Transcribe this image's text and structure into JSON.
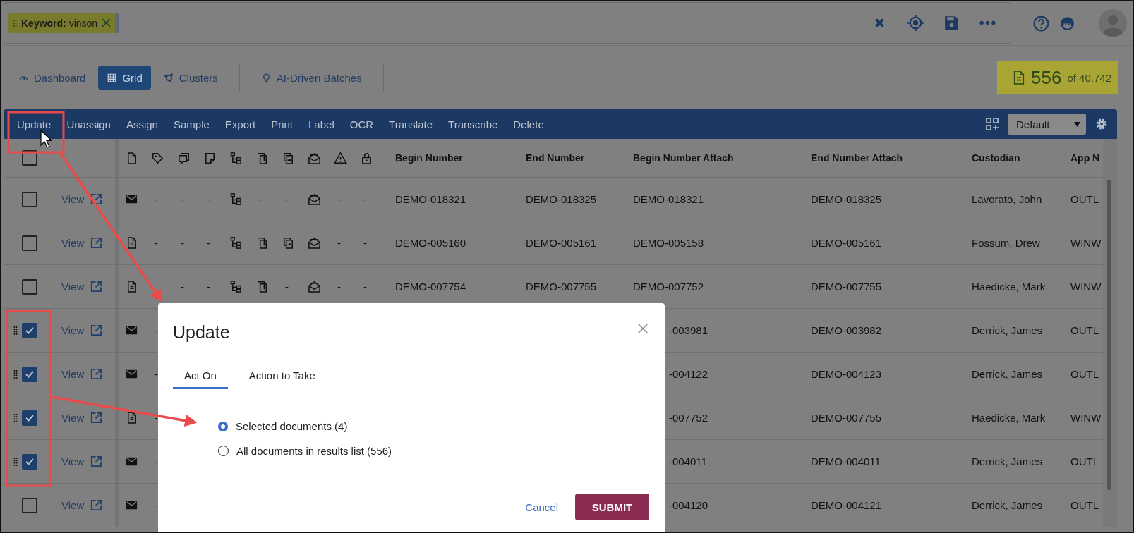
{
  "search_bar": {
    "chip": "**Keyword:** vinson"
  },
  "nav_tabs": [
    {
      "label": "Dashboard",
      "kind": "dashboard",
      "selected": false
    },
    {
      "label": "Grid",
      "kind": "grid",
      "selected": true
    },
    {
      "label": "Clusters",
      "kind": "clusters",
      "selected": false
    },
    {
      "label": "AI-Driven Batches",
      "kind": "batches",
      "selected": false
    }
  ],
  "result_count": {
    "count": "556",
    "total": "of 40,742"
  },
  "toolbar": {
    "actions": [
      "Update",
      "Unassign",
      "Assign",
      "Sample",
      "Export",
      "Print",
      "Label",
      "OCR",
      "Translate",
      "Transcribe",
      "Delete"
    ],
    "layout_select": "Default"
  },
  "table": {
    "header_checked": false,
    "columns": [
      "Begin Number",
      "End Number",
      "Begin Number Attach",
      "End Number Attach",
      "Custodian",
      "App N"
    ],
    "rows": [
      {
        "checked": false,
        "view": "View",
        "icons": [
          {
            "kind": "email"
          },
          {
            "kind": "dash",
            "text": "-"
          },
          {
            "kind": "dash",
            "text": "-"
          },
          {
            "kind": "dash",
            "text": "-"
          },
          {
            "kind": "family"
          },
          {
            "kind": "dash",
            "text": "-"
          },
          {
            "kind": "dash",
            "text": "-"
          },
          {
            "kind": "thread"
          },
          {
            "kind": "dash",
            "text": "-"
          },
          {
            "kind": "dash",
            "text": "-"
          }
        ],
        "cells": [
          "DEMO-018321",
          "DEMO-018325",
          "DEMO-018321",
          "DEMO-018325",
          "Lavorato, John",
          "OUTL"
        ]
      },
      {
        "checked": false,
        "view": "View",
        "icons": [
          {
            "kind": "doc"
          },
          {
            "kind": "dash",
            "text": "-"
          },
          {
            "kind": "dash",
            "text": "-"
          },
          {
            "kind": "dash",
            "text": "-"
          },
          {
            "kind": "family"
          },
          {
            "kind": "copies"
          },
          {
            "kind": "duplicate"
          },
          {
            "kind": "thread"
          },
          {
            "kind": "dash",
            "text": "-"
          },
          {
            "kind": "dash",
            "text": "-"
          }
        ],
        "cells": [
          "DEMO-005160",
          "DEMO-005161",
          "DEMO-005158",
          "DEMO-005161",
          "Fossum, Drew",
          "WINW"
        ]
      },
      {
        "checked": false,
        "view": "View",
        "icons": [
          {
            "kind": "doc"
          },
          {
            "kind": "blank"
          },
          {
            "kind": "dash",
            "text": "-"
          },
          {
            "kind": "dash",
            "text": "-"
          },
          {
            "kind": "family"
          },
          {
            "kind": "copies"
          },
          {
            "kind": "dash",
            "text": "-"
          },
          {
            "kind": "thread"
          },
          {
            "kind": "dash",
            "text": "-"
          },
          {
            "kind": "dash",
            "text": "-"
          }
        ],
        "cells": [
          "DEMO-007754",
          "DEMO-007755",
          "DEMO-007752",
          "DEMO-007755",
          "Haedicke, Mark",
          "WINW"
        ]
      },
      {
        "checked": true,
        "view": "View",
        "icons": [
          {
            "kind": "email"
          },
          {
            "kind": "dash",
            "text": "-"
          }
        ],
        "cells": [
          null,
          null,
          "-003981",
          "DEMO-003982",
          "Derrick, James",
          "OUTL"
        ]
      },
      {
        "checked": true,
        "view": "View",
        "icons": [
          {
            "kind": "email"
          },
          {
            "kind": "dash",
            "text": "-"
          }
        ],
        "cells": [
          null,
          null,
          "-004122",
          "DEMO-004123",
          "Derrick, James",
          "OUTL"
        ]
      },
      {
        "checked": true,
        "view": "View",
        "icons": [
          {
            "kind": "doc"
          },
          {
            "kind": "dash",
            "text": "-"
          }
        ],
        "cells": [
          null,
          null,
          "-007752",
          "DEMO-007755",
          "Haedicke, Mark",
          "WINW"
        ]
      },
      {
        "checked": true,
        "view": "View",
        "icons": [
          {
            "kind": "email"
          },
          {
            "kind": "dash",
            "text": "-"
          }
        ],
        "cells": [
          null,
          null,
          "-004011",
          "DEMO-004011",
          "Derrick, James",
          "OUTL"
        ]
      },
      {
        "checked": false,
        "view": "View",
        "icons": [
          {
            "kind": "email"
          },
          {
            "kind": "dash",
            "text": "-"
          }
        ],
        "cells": [
          null,
          null,
          "-004120",
          "DEMO-004121",
          "Derrick, James",
          "OUTL"
        ]
      }
    ]
  },
  "dialog": {
    "title": "Update",
    "tabs": [
      {
        "label": "Act On",
        "selected": true
      },
      {
        "label": "Action to Take",
        "selected": false
      }
    ],
    "options": [
      {
        "label": "Selected documents (4)",
        "selected": true
      },
      {
        "label": "All documents in results list (556)",
        "selected": false
      }
    ],
    "cancel": "Cancel",
    "submit": "SUBMIT"
  }
}
